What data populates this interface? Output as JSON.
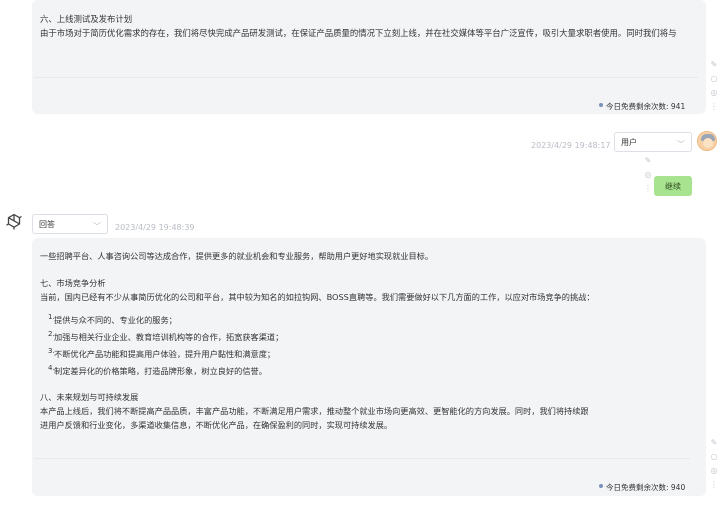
{
  "messages": [
    {
      "role": "assistant",
      "section_title": "六、上线测试及发布计划",
      "text": "由于市场对于简历优化需求的存在，我们将尽快完成产品研发测试，在保证产品质量的情况下立刻上线，并在社交媒体等平台广泛宣传，吸引大量求职者使用。同时我们将与",
      "quota": "今日免费剩余次数: 941"
    },
    {
      "role": "user",
      "timestamp": "2023/4/29 19:48:17",
      "role_select": "用户",
      "text": "继续"
    },
    {
      "role": "assistant",
      "role_select": "回答",
      "timestamp": "2023/4/29 19:48:39",
      "intro": "一些招聘平台、人事咨询公司等达成合作，提供更多的就业机会和专业服务，帮助用户更好地实现就业目标。",
      "section7_title": "七、市场竞争分析",
      "section7_text": "当前，国内已经有不少从事简历优化的公司和平台，其中较为知名的如拉钩网、BOSS直聘等。我们需要做好以下几方面的工作，以应对市场竞争的挑战：",
      "items": [
        {
          "num": "1.",
          "text": "提供与众不同的、专业化的服务；"
        },
        {
          "num": "2.",
          "text": "加强与相关行业企业、教育培训机构等的合作，拓宽获客渠道；"
        },
        {
          "num": "3.",
          "text": "不断优化产品功能和提高用户体验，提升用户黏性和满意度；"
        },
        {
          "num": "4.",
          "text": "制定差异化的价格策略，打造品牌形象，树立良好的信誉。"
        }
      ],
      "section8_title": "八、未来规划与可持续发展",
      "section8_text_line1": "本产品上线后，我们将不断提高产品品质，丰富产品功能，不断满足用户需求，推动整个就业市场向更高效、更智能化的方向发展。同时，我们将持续跟",
      "section8_text_line2": "进用户反馈和行业变化，多渠道收集信息，不断优化产品，在确保盈利的同时，实现可持续发展。",
      "quota": "今日免费剩余次数: 940"
    }
  ],
  "icons": {
    "edit": "pencil-icon",
    "refresh": "refresh-icon",
    "copy": "copy-icon",
    "more": "more-icon",
    "assistant_logo": "openai-logo-icon",
    "user_avatar": "user-avatar"
  },
  "colors": {
    "bubble_bg": "#f3f4f6",
    "continue_bubble": "#a8e38f"
  }
}
